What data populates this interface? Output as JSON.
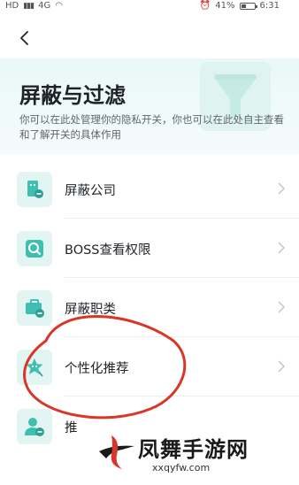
{
  "status_bar": {
    "left": "HD",
    "signal": "4G",
    "right_icons": "alarm",
    "battery": "41%",
    "battery_level": 0.41,
    "time": "6:31"
  },
  "header": {
    "title": "屏蔽与过滤",
    "description": "你可以在此处管理你的隐私开关，你也可以在此处自主查看和了解开关的具体作用"
  },
  "menu": {
    "items": [
      {
        "label": "屏蔽公司",
        "icon": "company-block-icon"
      },
      {
        "label": "BOSS查看权限",
        "icon": "boss-view-permission-icon"
      },
      {
        "label": "屏蔽职类",
        "icon": "job-category-block-icon"
      },
      {
        "label": "个性化推荐",
        "icon": "personalized-recommend-icon"
      },
      {
        "label": "推",
        "icon": "user-block-icon"
      }
    ]
  },
  "watermark": {
    "text": "凤舞手游网",
    "url": "xxqyfw.com"
  },
  "colors": {
    "accent": "#3fbfb1",
    "icon_bg": "#e2f5f3",
    "annotation": "#d9362a"
  }
}
